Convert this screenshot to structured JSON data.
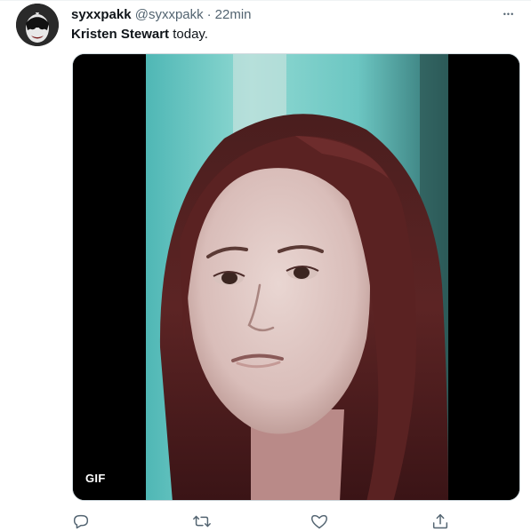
{
  "tweet": {
    "display_name": "syxxpakk",
    "handle": "@syxxpakk",
    "separator": "·",
    "time": "22min",
    "text_bold": "Kristen Stewart",
    "text_rest": " today.",
    "more_label": "•••"
  },
  "media": {
    "badge": "GIF"
  },
  "actions": [
    {
      "name": "reply",
      "icon": "reply-icon"
    },
    {
      "name": "retweet",
      "icon": "retweet-icon"
    },
    {
      "name": "like",
      "icon": "heart-icon"
    },
    {
      "name": "share",
      "icon": "share-icon"
    }
  ],
  "colors": {
    "text_primary": "#0f1419",
    "text_secondary": "#536471",
    "border": "#cfd9de",
    "media_background": "#000000"
  }
}
